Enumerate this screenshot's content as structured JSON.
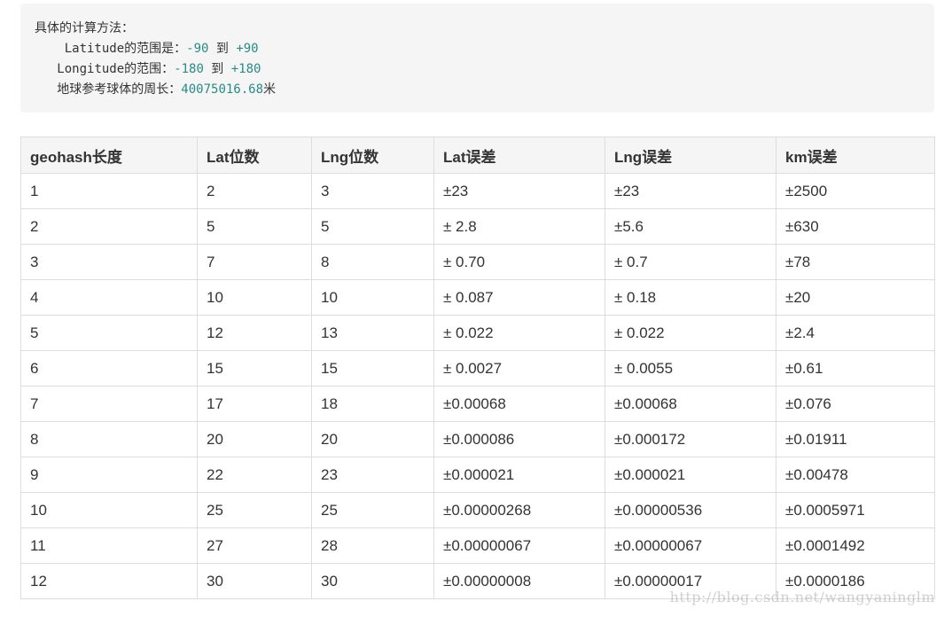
{
  "code_block": {
    "line1": "具体的计算方法：",
    "line2_prefix": "Latitude的范围是：",
    "line2_v1": "-90",
    "line2_mid": " 到 ",
    "line2_v2": "+90",
    "line3_prefix": "Longitude的范围：",
    "line3_v1": "-180",
    "line3_mid": " 到 ",
    "line3_v2": "+180",
    "line4_prefix": "地球参考球体的周长：",
    "line4_value": "40075016.68",
    "line4_suffix": "米",
    "number_color": "#2a8a86"
  },
  "table": {
    "headers": [
      "geohash长度",
      "Lat位数",
      "Lng位数",
      "Lat误差",
      "Lng误差",
      "km误差"
    ],
    "rows": [
      [
        "1",
        "2",
        "3",
        "±23",
        "±23",
        "±2500"
      ],
      [
        "2",
        "5",
        "5",
        "± 2.8",
        "±5.6",
        "±630"
      ],
      [
        "3",
        "7",
        "8",
        "± 0.70",
        "± 0.7",
        "±78"
      ],
      [
        "4",
        "10",
        "10",
        "± 0.087",
        "± 0.18",
        "±20"
      ],
      [
        "5",
        "12",
        "13",
        "± 0.022",
        "± 0.022",
        "±2.4"
      ],
      [
        "6",
        "15",
        "15",
        "± 0.0027",
        "± 0.0055",
        "±0.61"
      ],
      [
        "7",
        "17",
        "18",
        "±0.00068",
        "±0.00068",
        "±0.076"
      ],
      [
        "8",
        "20",
        "20",
        "±0.000086",
        "±0.000172",
        "±0.01911"
      ],
      [
        "9",
        "22",
        "23",
        "±0.000021",
        "±0.000021",
        "±0.00478"
      ],
      [
        "10",
        "25",
        "25",
        "±0.00000268",
        "±0.00000536",
        "±0.0005971"
      ],
      [
        "11",
        "27",
        "28",
        "±0.00000067",
        "±0.00000067",
        "±0.0001492"
      ],
      [
        "12",
        "30",
        "30",
        "±0.00000008",
        "±0.00000017",
        "±0.0000186"
      ]
    ]
  },
  "watermark": "http://blog.csdn.net/wangyaninglm"
}
